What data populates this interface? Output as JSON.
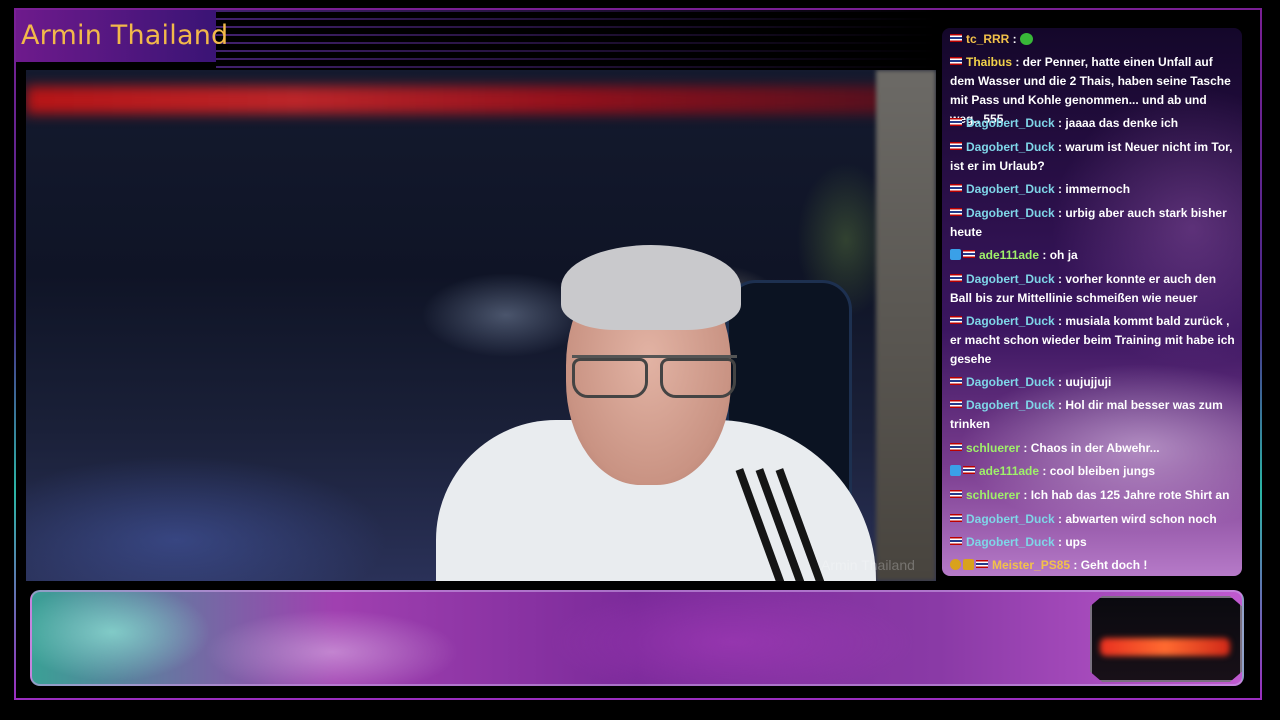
{
  "channel": {
    "title": "Armin Thailand",
    "watermark": "Armin Thailand"
  },
  "colors": {
    "title_gold": "#f2b94a",
    "frame_purple": "#7a1f95",
    "frame_teal": "#2bb5a5"
  },
  "chat": {
    "messages": [
      {
        "user": "tc_RRR",
        "user_color": "#f2c24a",
        "text": " : ",
        "emote": "green-emote"
      },
      {
        "user": "Thaibus",
        "user_color": "#f2d24a",
        "text": " : der Penner, hatte einen Unfall auf dem Wasser und die 2 Thais, haben seine Tasche mit Pass und Kohle genommen... und ab und weg.. 555"
      },
      {
        "user": "Dagobert_Duck",
        "user_color": "#7fd6e8",
        "text": " : jaaaa das denke ich"
      },
      {
        "user": "Dagobert_Duck",
        "user_color": "#7fd6e8",
        "text": " : warum ist Neuer nicht im Tor, ist er im Urlaub?"
      },
      {
        "user": "Dagobert_Duck",
        "user_color": "#7fd6e8",
        "text": " : immernoch"
      },
      {
        "user": "Dagobert_Duck",
        "user_color": "#7fd6e8",
        "text": " : urbig aber auch stark bisher heute"
      },
      {
        "user": "ade111ade",
        "user_color": "#9ff06a",
        "text": " : oh ja",
        "badge": "blue"
      },
      {
        "user": "Dagobert_Duck",
        "user_color": "#7fd6e8",
        "text": " : vorher konnte er auch den Ball bis zur Mittellinie schmeißen wie neuer"
      },
      {
        "user": "Dagobert_Duck",
        "user_color": "#7fd6e8",
        "text": " : musiala kommt bald zurück , er macht schon wieder beim Training mit habe ich gesehe"
      },
      {
        "user": "Dagobert_Duck",
        "user_color": "#7fd6e8",
        "text": " : uujujjuji"
      },
      {
        "user": "Dagobert_Duck",
        "user_color": "#7fd6e8",
        "text": " : Hol dir mal besser was zum trinken"
      },
      {
        "user": "schluerer",
        "user_color": "#9ff06a",
        "text": " : Chaos in der Abwehr..."
      },
      {
        "user": "ade111ade",
        "user_color": "#9ff06a",
        "text": " : cool bleiben jungs",
        "badge": "blue"
      },
      {
        "user": "schluerer",
        "user_color": "#9ff06a",
        "text": " : Ich hab das 125 Jahre rote Shirt an"
      },
      {
        "user": "Dagobert_Duck",
        "user_color": "#7fd6e8",
        "text": " : abwarten wird schon noch"
      },
      {
        "user": "Dagobert_Duck",
        "user_color": "#7fd6e8",
        "text": " : ups"
      },
      {
        "user": "Meister_PS85",
        "user_color": "#f2c24a",
        "text": " : Geht doch !",
        "badge": "gold"
      }
    ]
  }
}
